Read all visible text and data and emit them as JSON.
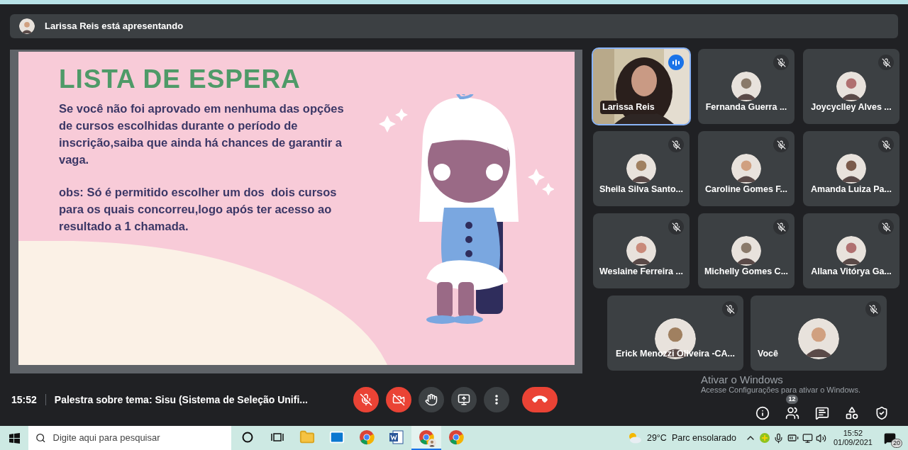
{
  "presenter_banner": {
    "text": "Larissa Reis está apresentando"
  },
  "slide": {
    "title": "LISTA DE ESPERA",
    "paragraphs": [
      "Se você não foi aprovado em nenhuma das opções de cursos escolhidas durante o período de inscrição,saiba que ainda há chances de garantir a vaga.",
      "obs: Só é permitido escolher um dos  dois cursos para os quais concorreu,logo após ter acesso ao resultado a 1 chamada."
    ]
  },
  "participants": [
    {
      "name": "Larissa Reis",
      "kind": "video",
      "muted": false,
      "speaking": true
    },
    {
      "name": "Fernanda Guerra ...",
      "kind": "avatar",
      "muted": true,
      "speaking": false
    },
    {
      "name": "Joycyclley Alves ...",
      "kind": "avatar",
      "muted": true,
      "speaking": false
    },
    {
      "name": "Sheila Silva Santo...",
      "kind": "avatar",
      "muted": true,
      "speaking": false
    },
    {
      "name": "Caroline Gomes F...",
      "kind": "avatar",
      "muted": true,
      "speaking": false
    },
    {
      "name": "Amanda Luiza Pa...",
      "kind": "avatar",
      "muted": true,
      "speaking": false
    },
    {
      "name": "Weslaine Ferreira ...",
      "kind": "avatar",
      "muted": true,
      "speaking": false
    },
    {
      "name": "Michelly Gomes C...",
      "kind": "avatar",
      "muted": true,
      "speaking": false
    },
    {
      "name": "Allana Vitórya Ga...",
      "kind": "avatar",
      "muted": true,
      "speaking": false
    },
    {
      "name": "Erick Menozzi Oliveira -CA...",
      "kind": "avatar",
      "muted": true,
      "speaking": false
    },
    {
      "name": "Você",
      "kind": "avatar",
      "muted": true,
      "speaking": false
    }
  ],
  "meeting_bar": {
    "time": "15:52",
    "title": "Palestra sobre tema: Sisu (Sistema de Seleção Unifi..."
  },
  "controls": [
    {
      "kind": "mic",
      "off": true
    },
    {
      "kind": "camera",
      "off": true
    },
    {
      "kind": "hand",
      "off": false
    },
    {
      "kind": "present",
      "off": false
    },
    {
      "kind": "more",
      "off": false
    },
    {
      "kind": "hangup"
    }
  ],
  "side_icons": [
    {
      "kind": "info"
    },
    {
      "kind": "people",
      "badge": "12"
    },
    {
      "kind": "chat"
    },
    {
      "kind": "activities"
    },
    {
      "kind": "safety"
    }
  ],
  "windows_notice": {
    "title": "Ativar o Windows",
    "text": "Acesse Configurações para ativar o Windows."
  },
  "taskbar": {
    "search_placeholder": "Digite aqui para pesquisar",
    "apps": [
      {
        "kind": "cortana",
        "selected": false
      },
      {
        "kind": "task-view",
        "selected": false
      },
      {
        "kind": "explorer",
        "selected": false
      },
      {
        "kind": "mail",
        "selected": false
      },
      {
        "kind": "chrome",
        "selected": false
      },
      {
        "kind": "word",
        "selected": false
      },
      {
        "kind": "chrome-profile",
        "selected": true
      },
      {
        "kind": "chrome",
        "selected": false
      }
    ],
    "weather": {
      "temperature": "29°C",
      "condition": "Parc ensolarado"
    },
    "clock": {
      "time": "15:52",
      "date": "01/09/2021"
    },
    "notifications": "20"
  }
}
